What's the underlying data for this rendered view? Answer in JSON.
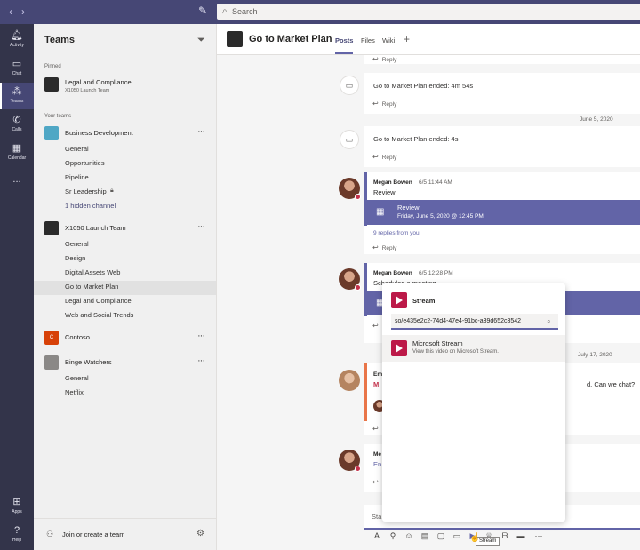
{
  "topbar": {
    "back_icon": "chevron-left-icon",
    "forward_icon": "chevron-right-icon",
    "compose_icon": "compose-icon",
    "search_placeholder": "Search",
    "accent": "#464775"
  },
  "rail": {
    "items": [
      {
        "label": "Activity",
        "icon": "bell-icon"
      },
      {
        "label": "Chat",
        "icon": "chat-icon"
      },
      {
        "label": "Teams",
        "icon": "teams-icon"
      },
      {
        "label": "Calls",
        "icon": "phone-icon"
      },
      {
        "label": "Calendar",
        "icon": "calendar-icon"
      },
      {
        "label": "...",
        "icon": "more-icon"
      }
    ],
    "bottom": [
      {
        "label": "Apps",
        "icon": "apps-icon"
      },
      {
        "label": "Help",
        "icon": "help-icon"
      }
    ]
  },
  "panel": {
    "title": "Teams",
    "pinned_label": "Pinned",
    "pinned": {
      "name": "Legal and Compliance",
      "sub": "X1050 Launch Team"
    },
    "your_teams_label": "Your teams",
    "teams": [
      {
        "name": "Business Development",
        "channels": [
          "General",
          "Opportunities",
          "Pipeline",
          "Sr Leadership"
        ],
        "hidden_link": "1 hidden channel"
      },
      {
        "name": "X1050 Launch Team",
        "channels": [
          "General",
          "Design",
          "Digital Assets Web",
          "Go to Market Plan",
          "Legal and Compliance",
          "Web and Social Trends"
        ]
      },
      {
        "name": "Contoso",
        "initial": "C"
      },
      {
        "name": "Binge Watchers",
        "channels": [
          "General",
          "Netflix"
        ]
      }
    ],
    "footer": "Join or create a team"
  },
  "header": {
    "title": "Go to Market Plan",
    "tabs": [
      "Posts",
      "Files",
      "Wiki"
    ],
    "add_icon": "plus-icon"
  },
  "conversation": {
    "reply_label": "Reply",
    "sys1": "Go to Market Plan ended: 4m 54s",
    "date1": "June 5, 2020",
    "sys2": "Go to Market Plan ended: 4s",
    "msg1": {
      "author": "Megan Bowen",
      "time": "6/5 11:44 AM",
      "text": "Review",
      "event_title": "Review",
      "event_date": "Friday, June 5, 2020 @ 12:45 PM",
      "replies": "9 replies from you"
    },
    "msg2": {
      "author": "Megan Bowen",
      "time": "6/5 12:28 PM",
      "text": "Scheduled a meeting"
    },
    "date2": "July 17, 2020",
    "msg3_author_part": "Em",
    "msg3_tail": "d. Can we chat?",
    "msg4_author_part": "Me",
    "msg4_line2": "En",
    "composer_part": "Sta"
  },
  "popup": {
    "title": "Stream",
    "input_value": "so/e435e2c2-74d4-47e4-91bc-a39d652c3542",
    "item_name": "Microsoft Stream",
    "item_desc": "View this video on Microsoft Stream.",
    "brand": "#bc1948"
  },
  "tooltip": "Stream"
}
